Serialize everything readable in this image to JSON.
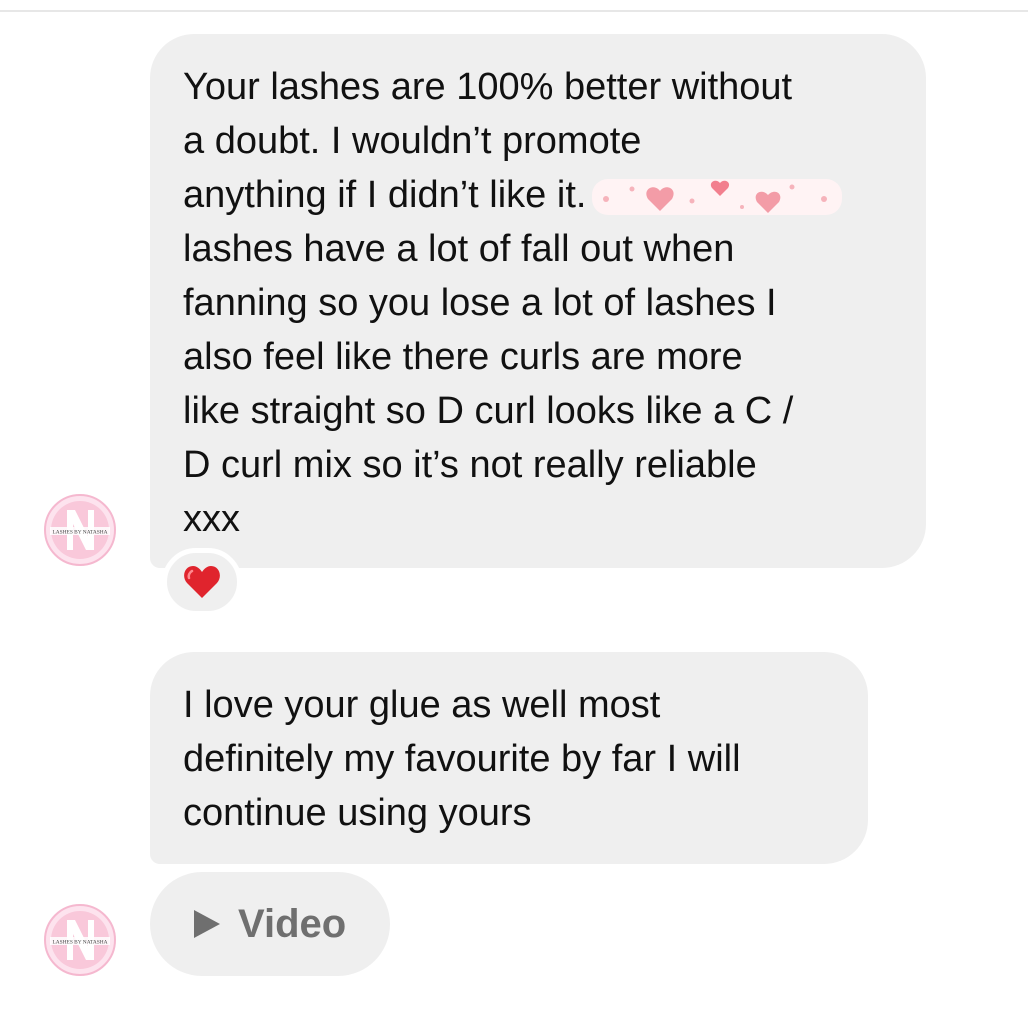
{
  "messages": [
    {
      "lines": [
        "Your lashes are 100% better without",
        "a doubt. I wouldn’t promote",
        "anything if I didn’t like it.",
        "lashes have a lot of fall out when",
        "fanning so you lose a lot of lashes I",
        "also feel like there curls are more",
        "like straight so D curl looks like a C /",
        "D curl mix so it’s not really reliable",
        "xxx"
      ],
      "reaction": "heart"
    },
    {
      "lines": [
        "I love your glue as well most",
        "definitely my favourite by far I will",
        "continue using yours"
      ]
    }
  ],
  "attachment": {
    "label": "Video",
    "icon": "play-icon"
  },
  "avatar": {
    "letter": "N",
    "caption": "LASHES BY NATASHA"
  },
  "colors": {
    "bubble": "#efefef",
    "text": "#111111",
    "reaction_heart": "#e0242d",
    "avatar_ring": "#f5b8cf"
  }
}
